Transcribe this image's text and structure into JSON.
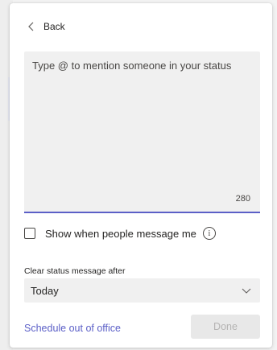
{
  "back": {
    "label": "Back",
    "icon": "chevron-left-icon"
  },
  "status": {
    "placeholder": "Type @ to mention someone in your status",
    "value": "",
    "char_count": "280",
    "accent_color": "#5b5fc7"
  },
  "show_when_message": {
    "label": "Show when people message me",
    "checked": false,
    "info_icon": "info-icon",
    "info_glyph": "i"
  },
  "clear_after": {
    "label": "Clear status message after",
    "selected": "Today",
    "icon": "chevron-down-icon"
  },
  "footer": {
    "schedule_link": "Schedule out of office",
    "done_label": "Done",
    "link_color": "#5b5fc7"
  }
}
